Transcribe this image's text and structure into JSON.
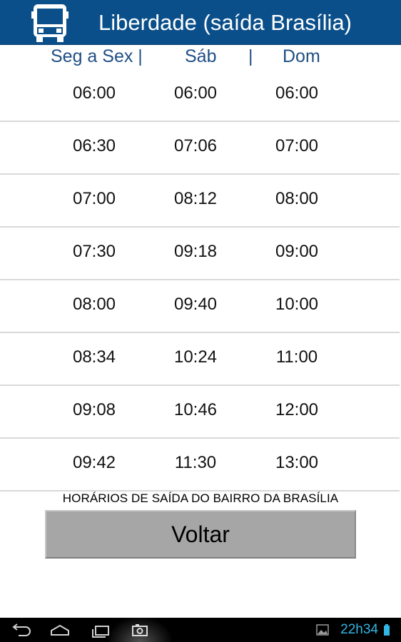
{
  "header": {
    "title": "Liberdade (saída Brasília)",
    "bg_color": "#0a4f8a",
    "icon": "bus-icon"
  },
  "columns": {
    "weekdays": "Seg a Sex |",
    "saturday": "Sáb",
    "separator": "|",
    "sunday": "Dom",
    "color": "#1f4f85"
  },
  "rows": [
    [
      "06:00",
      "06:00",
      "06:00"
    ],
    [
      "06:30",
      "07:06",
      "07:00"
    ],
    [
      "07:00",
      "08:12",
      "08:00"
    ],
    [
      "07:30",
      "09:18",
      "09:00"
    ],
    [
      "08:00",
      "09:40",
      "10:00"
    ],
    [
      "08:34",
      "10:24",
      "11:00"
    ],
    [
      "09:08",
      "10:46",
      "12:00"
    ],
    [
      "09:42",
      "11:30",
      "13:00"
    ]
  ],
  "footer": {
    "label": "HORÁRIOS DE SAÍDA DO BAIRRO DA BRASÍLIA",
    "back_button": "Voltar"
  },
  "system_bar": {
    "clock": "22h34",
    "icons": [
      "back-icon",
      "home-icon",
      "recent-apps-icon",
      "screenshot-icon",
      "gallery-notification-icon",
      "battery-icon"
    ],
    "clock_color": "#33b5e5"
  }
}
